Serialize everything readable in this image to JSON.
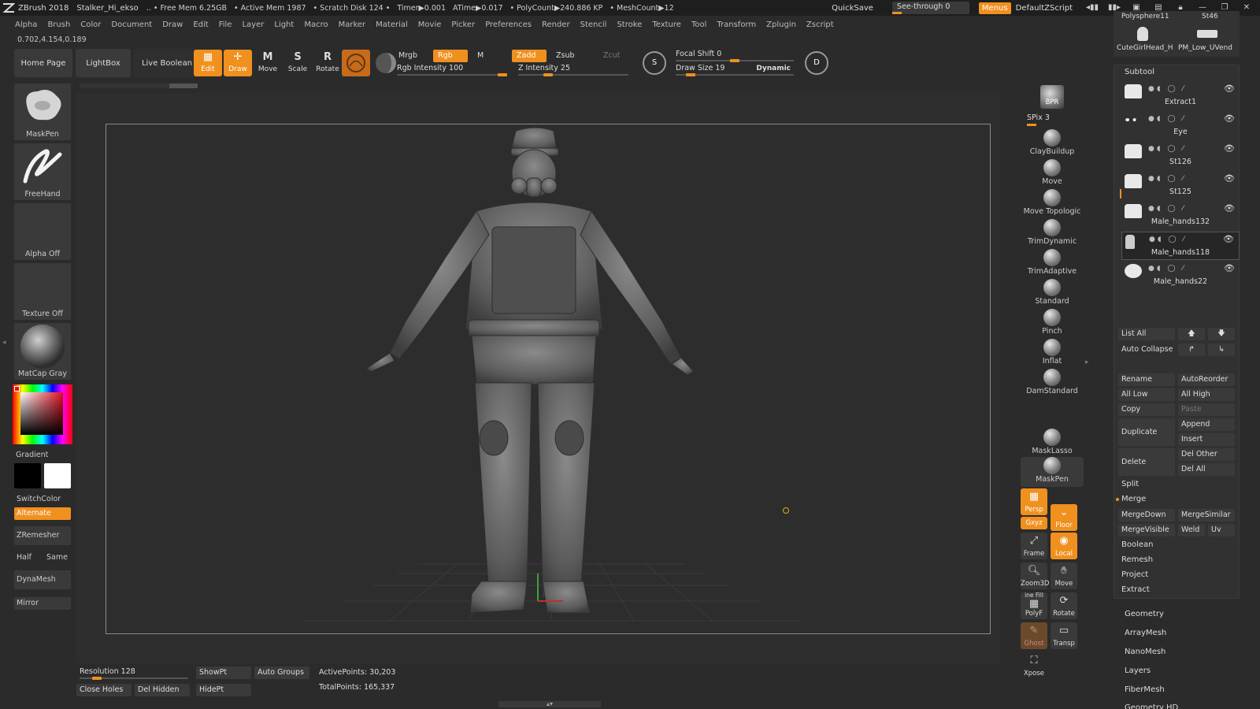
{
  "titlebar": {
    "app": "ZBrush 2018",
    "doc": "Stalker_Hi_ekso",
    "stats": [
      ".. • Free Mem 6.25GB",
      "• Active Mem 1987",
      "• Scratch Disk 124 •",
      "Timer▶0.001",
      "ATime▶0.017",
      "• PolyCount▶240.886 KP",
      "• MeshCount▶12"
    ],
    "quicksave": "QuickSave",
    "see_through": "See-through  0",
    "see_through_level": 0,
    "menus": "Menus",
    "script": "DefaultZScript"
  },
  "menubar": [
    "Alpha",
    "Brush",
    "Color",
    "Document",
    "Draw",
    "Edit",
    "File",
    "Layer",
    "Light",
    "Macro",
    "Marker",
    "Material",
    "Movie",
    "Picker",
    "Preferences",
    "Render",
    "Stencil",
    "Stroke",
    "Texture",
    "Tool",
    "Transform",
    "Zplugin",
    "Zscript"
  ],
  "coords": "0.702,4.154,0.189",
  "shelf": {
    "home": "Home Page",
    "lightbox": "LightBox",
    "live_boolean": "Live Boolean",
    "edit": "Edit",
    "draw": "Draw",
    "move": "Move",
    "scale": "Scale",
    "rotate": "Rotate",
    "move_glyph": "M",
    "scale_glyph": "S",
    "rotate_glyph": "R",
    "mrgb": "Mrgb",
    "rgb": "Rgb",
    "m": "M",
    "zadd": "Zadd",
    "zsub": "Zsub",
    "zcut": "Zcut",
    "rgb_intensity": "Rgb Intensity 100",
    "rgb_intensity_value": 100,
    "z_intensity": "Z Intensity 25",
    "z_intensity_value": 25,
    "focal_shift": "Focal Shift 0",
    "focal_shift_value": 0,
    "draw_size": "Draw Size 19",
    "draw_size_value": 19,
    "dynamic": "Dynamic",
    "s_letter": "S",
    "d_letter": "D"
  },
  "left": {
    "brush": "MaskPen",
    "stroke": "FreeHand",
    "alpha": "Alpha Off",
    "texture": "Texture Off",
    "material": "MatCap Gray",
    "gradient": "Gradient",
    "switchcolor": "SwitchColor",
    "alternate": "Alternate",
    "zremesher": "ZRemesher",
    "half": "Half",
    "same": "Same",
    "dynamesh": "DynaMesh",
    "mirror": "Mirror"
  },
  "brushes": [
    "ClayBuildup",
    "Move",
    "Move Topologic",
    "TrimDynamic",
    "TrimAdaptive",
    "Standard",
    "Pinch",
    "Inflat",
    "DamStandard"
  ],
  "bpr": "BPR",
  "spix": "SPix 3",
  "spix_value": 3,
  "masklasso": "MaskLasso",
  "maskpen2": "MaskPen",
  "view_buttons": {
    "persp": "Persp",
    "floor": "Floor",
    "xyz": "Gxyz",
    "frame": "Frame",
    "local": "Local",
    "zoom3d": "Zoom3D",
    "move": "Move",
    "polyf": "PolyF",
    "rotate": "Rotate",
    "line_fill": "ine Fill",
    "ghost": "Ghost",
    "transp": "Transp",
    "xpose": "Xpose"
  },
  "top_tools": [
    "Polysphere11",
    "St46",
    "CuteGirlHead_H",
    "PM_Low_UVend"
  ],
  "subtool": {
    "title": "Subtool",
    "items": [
      "Extract1",
      "Eye",
      "St126",
      "St125",
      "Male_hands132",
      "Male_hands118",
      "Male_hands22"
    ],
    "list_all": "List All",
    "auto_collapse": "Auto Collapse",
    "rename": "Rename",
    "autoreorder": "AutoReorder",
    "all_low": "All Low",
    "all_high": "All High",
    "copy": "Copy",
    "paste": "Paste",
    "duplicate": "Duplicate",
    "append": "Append",
    "insert": "Insert",
    "delete": "Delete",
    "del_other": "Del Other",
    "del_all": "Del All",
    "split": "Split",
    "merge": "Merge",
    "mergedown": "MergeDown",
    "mergesimilar": "MergeSimilar",
    "mergevisible": "MergeVisible",
    "weld": "Weld",
    "uv": "Uv",
    "boolean": "Boolean",
    "remesh": "Remesh",
    "project": "Project",
    "extract": "Extract"
  },
  "sections": [
    "Geometry",
    "ArrayMesh",
    "NanoMesh",
    "Layers",
    "FiberMesh",
    "Geometry HD"
  ],
  "bottom": {
    "resolution": "Resolution 128",
    "resolution_value": 128,
    "showpt": "ShowPt",
    "auto_groups": "Auto Groups",
    "active_points": "ActivePoints: 30,203",
    "total_points": "TotalPoints: 165,337",
    "close_holes": "Close Holes",
    "del_hidden": "Del Hidden",
    "hidept": "HidePt"
  },
  "colors": {
    "accent": "#f0901e",
    "bg": "#2b2b2b",
    "panel": "#3a3a3a"
  }
}
